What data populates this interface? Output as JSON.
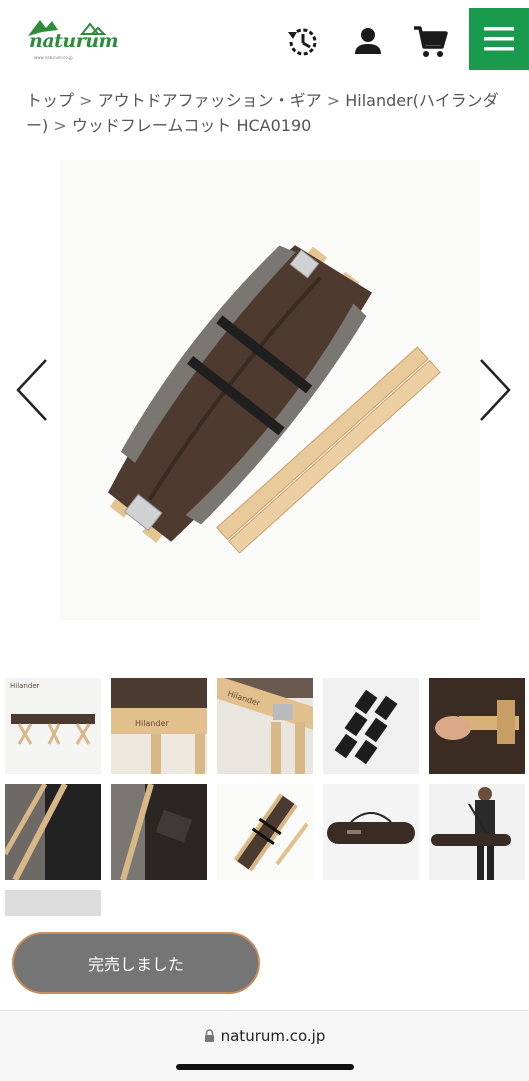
{
  "header": {
    "logo_text": "naturum",
    "logo_sub": "www.naturum.co.jp",
    "icons": [
      "history-icon",
      "account-icon",
      "cart-icon",
      "menu-icon"
    ],
    "brand_color": "#1a9a4d"
  },
  "breadcrumb": {
    "items": [
      "トップ",
      "アウトドアファッション・ギア",
      "Hilander(ハイランダー)",
      "ウッドフレームコット HCA0190"
    ],
    "separator": ">"
  },
  "gallery": {
    "main_alt": "ウッドフレームコット 収納状態",
    "thumb_labels": [
      "Hilander",
      "Hilander",
      "Hilander"
    ],
    "prev_icon": "chevron-left-icon",
    "next_icon": "chevron-right-icon",
    "thumb_count": 11
  },
  "purchase": {
    "soldout_label": "完売しました"
  },
  "browser": {
    "url": "naturum.co.jp",
    "lock_icon": "lock-icon"
  }
}
